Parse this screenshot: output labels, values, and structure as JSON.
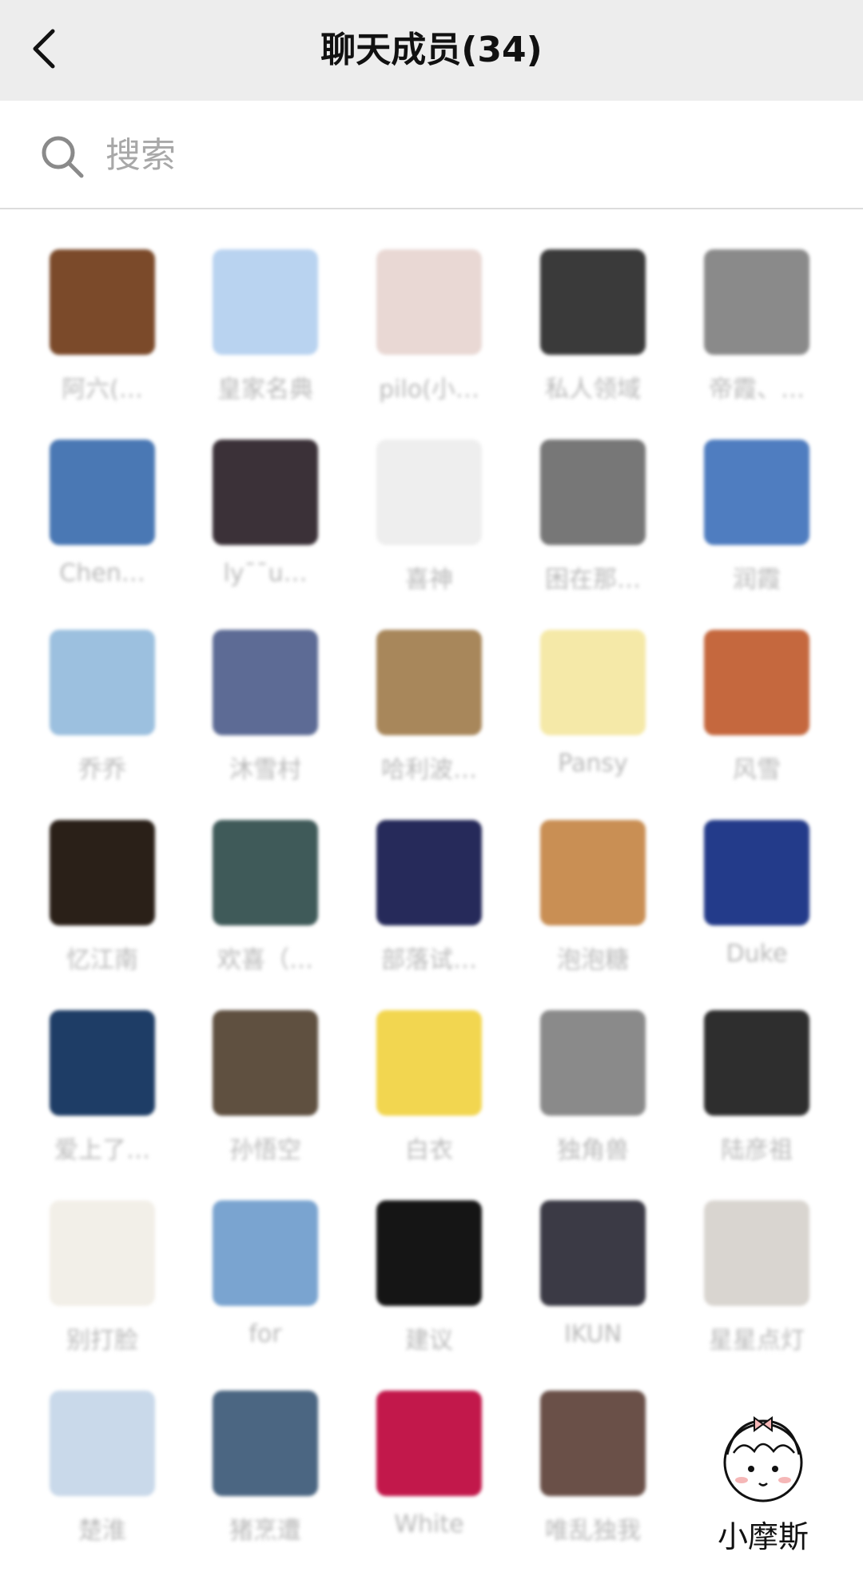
{
  "header": {
    "title": "聊天成员(34)"
  },
  "search": {
    "placeholder": "搜索",
    "value": ""
  },
  "members": [
    {
      "name": "阿六(…",
      "color": "#7b4a2a"
    },
    {
      "name": "皇家名典",
      "color": "#b9d3f0"
    },
    {
      "name": "pilo(小…",
      "color": "#e9d8d4"
    },
    {
      "name": "私人领域",
      "color": "#3a3a3a"
    },
    {
      "name": "帝霞、…",
      "color": "#8a8a8a"
    },
    {
      "name": "Chen…",
      "color": "#4a78b4"
    },
    {
      "name": "ly¯¯u…",
      "color": "#3b3138"
    },
    {
      "name": "喜神",
      "color": "#eeeeee"
    },
    {
      "name": "困在那…",
      "color": "#777777"
    },
    {
      "name": "润霞",
      "color": "#4f7dc0"
    },
    {
      "name": "乔乔",
      "color": "#9cc0df"
    },
    {
      "name": "沐雪村",
      "color": "#5d6b95"
    },
    {
      "name": "哈利波…",
      "color": "#a8875b"
    },
    {
      "name": "Pansy",
      "color": "#f5e9a8"
    },
    {
      "name": "风雪",
      "color": "#c5683e"
    },
    {
      "name": "忆江南",
      "color": "#2a2018"
    },
    {
      "name": "欢喜（…",
      "color": "#3f5a59"
    },
    {
      "name": "部落试…",
      "color": "#262a5a"
    },
    {
      "name": "泡泡糖",
      "color": "#c98f54"
    },
    {
      "name": "Duke",
      "color": "#233b8a"
    },
    {
      "name": "爱上了…",
      "color": "#1e3d66"
    },
    {
      "name": "孙悟空",
      "color": "#5f5040"
    },
    {
      "name": "白衣",
      "color": "#f2d650"
    },
    {
      "name": "独角兽",
      "color": "#8a8a8a"
    },
    {
      "name": "陆彦祖",
      "color": "#2e2e2e"
    },
    {
      "name": "别打脸",
      "color": "#f2efe8"
    },
    {
      "name": "for",
      "color": "#7aa4d0"
    },
    {
      "name": "建议",
      "color": "#151515"
    },
    {
      "name": "IKUN",
      "color": "#3b3a45"
    },
    {
      "name": "星星点灯",
      "color": "#d9d5d0"
    },
    {
      "name": "楚淮",
      "color": "#c9d9ea"
    },
    {
      "name": "猪烹遭",
      "color": "#4b6682"
    },
    {
      "name": "White",
      "color": "#c2184b"
    },
    {
      "name": "唯乱独我",
      "color": "#6a5048"
    }
  ],
  "watermark": {
    "text": "小摩斯"
  },
  "icons": {
    "back": "back-arrow-icon",
    "search": "search-icon"
  }
}
